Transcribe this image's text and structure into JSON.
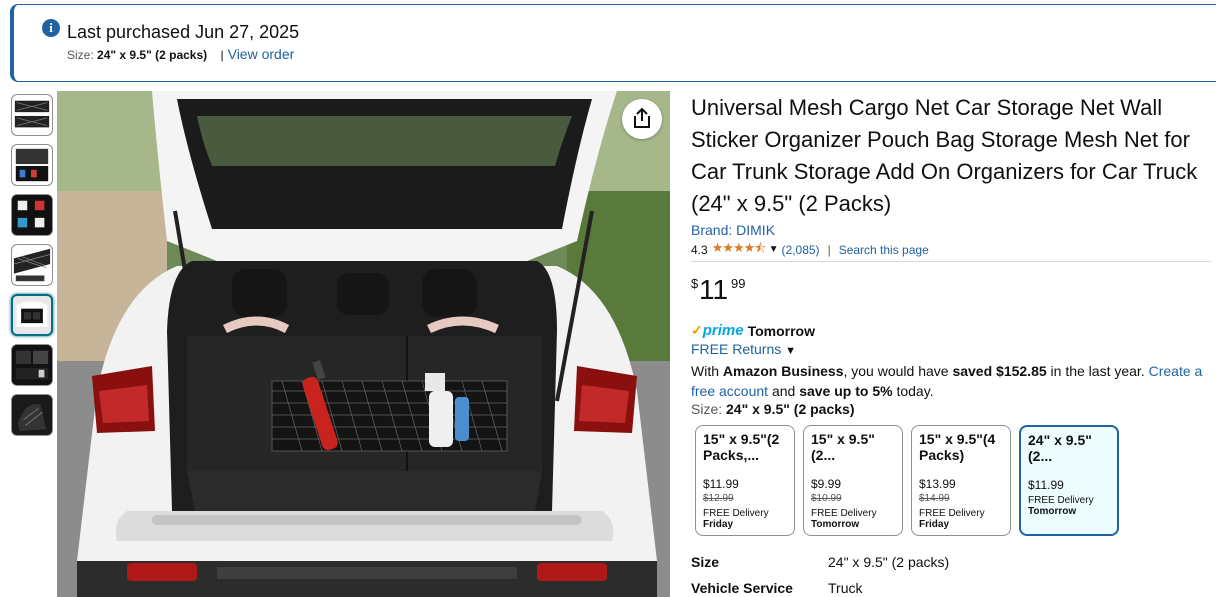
{
  "banner": {
    "purchased": "Last purchased Jun 27, 2025",
    "size_label": "Size:",
    "size_value": "24\" x 9.5\" (2 packs)",
    "separator": "|",
    "view_order": "View order",
    "icon": "info-icon"
  },
  "product": {
    "title": "Universal Mesh Cargo Net Car Storage Net Wall Sticker Organizer Pouch Bag Storage Mesh Net for Car Trunk Storage Add On Organizers for Car Truck (24\" x 9.5\"  (2 Packs)",
    "brand": "Brand: DIMIK",
    "rating": "4.3",
    "stars": "★★★★⯪",
    "rating_count": "(2,085)",
    "rating_sep": "|",
    "search_page": "Search this page",
    "price_symbol": "$",
    "price_whole": "11",
    "price_fraction": "99",
    "prime_check": "✓",
    "prime_word": "prime",
    "prime_delivery": "Tomorrow",
    "free_returns": "FREE Returns",
    "business_pre": "With ",
    "business_name": "Amazon Business",
    "business_mid": ", you would have ",
    "business_saved": "saved $152.85",
    "business_post": " in the last year. ",
    "business_link": "Create a free account",
    "business_and": " and ",
    "business_save": "save up to 5%",
    "business_end": " today.",
    "size_label": "Size: ",
    "size_value": "24\" x 9.5\"  (2 packs)"
  },
  "options": [
    {
      "name": "15\" x 9.5\"(2 Packs,...",
      "price": "$11.99",
      "list": "$12.99",
      "delivery": "FREE Delivery",
      "day": "Friday"
    },
    {
      "name": "15\" x 9.5\"  (2...",
      "price": "$9.99",
      "list": "$10.99",
      "delivery": "FREE Delivery",
      "day": "Tomorrow"
    },
    {
      "name": "15\" x 9.5\"(4 Packs)",
      "price": "$13.99",
      "list": "$14.99",
      "delivery": "FREE Delivery",
      "day": "Friday"
    },
    {
      "name": "24\" x 9.5\"  (2...",
      "price": "$11.99",
      "list": "",
      "delivery": "FREE Delivery",
      "day": "Tomorrow"
    }
  ],
  "specs": [
    {
      "key": "Size",
      "value": "24\" x 9.5\"  (2 packs)"
    },
    {
      "key": "Vehicle Service",
      "value": "Truck"
    }
  ],
  "colors": {
    "link": "#2162a1",
    "star": "#de7921",
    "prime": "#00a8e1",
    "selected_border": "#2162a1"
  }
}
